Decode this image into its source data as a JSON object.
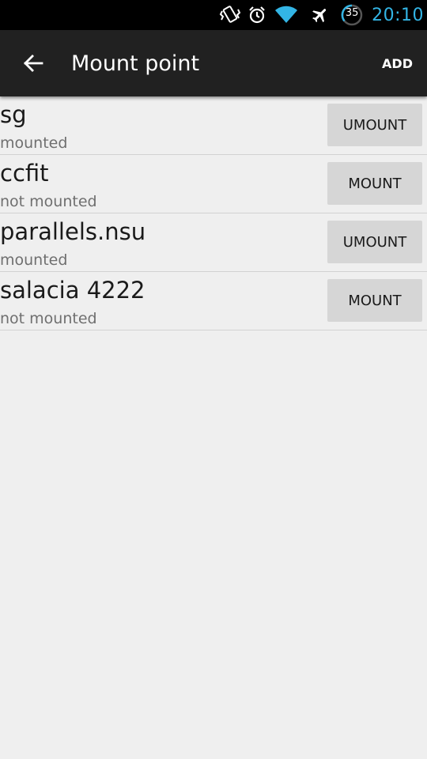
{
  "status_bar": {
    "battery_level": "35",
    "time": "20:10",
    "clock_color": "#33b5e5",
    "icons": [
      "vibrate-icon",
      "alarm-icon",
      "wifi-icon",
      "airplane-icon",
      "battery-icon"
    ]
  },
  "app_bar": {
    "title": "Mount point",
    "add_label": "ADD",
    "background": "#212121"
  },
  "list": {
    "items": [
      {
        "name": "sg",
        "status": "mounted",
        "action": "UMOUNT"
      },
      {
        "name": "ccfit",
        "status": "not mounted",
        "action": "MOUNT"
      },
      {
        "name": "parallels.nsu",
        "status": "mounted",
        "action": "UMOUNT"
      },
      {
        "name": "salacia 4222",
        "status": "not mounted",
        "action": "MOUNT"
      }
    ]
  }
}
